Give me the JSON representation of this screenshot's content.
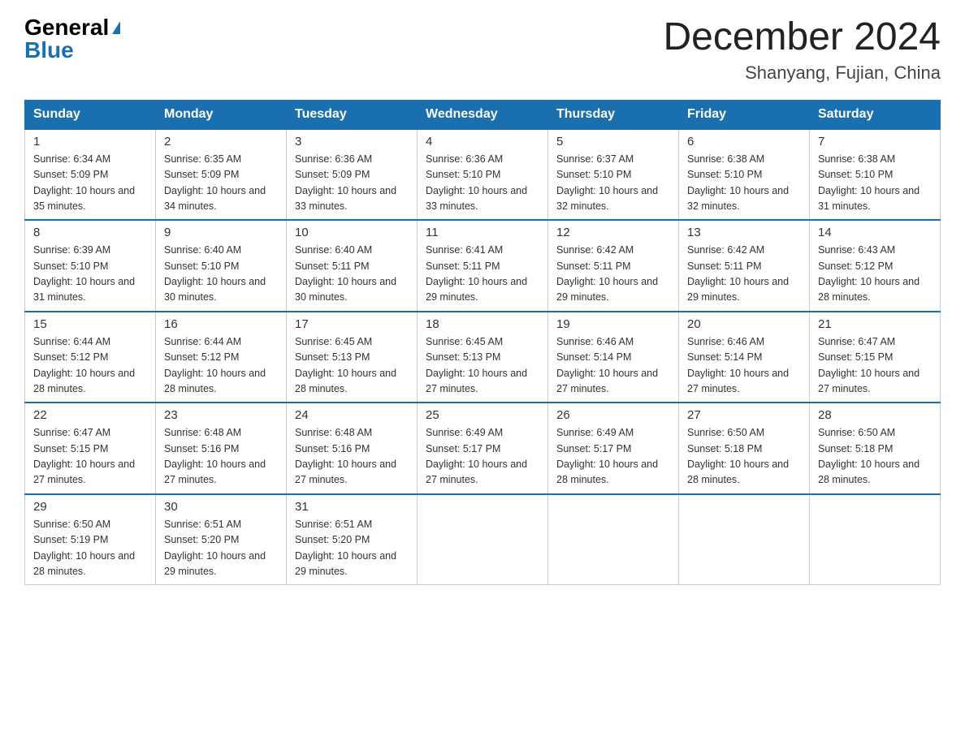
{
  "logo": {
    "general": "General",
    "blue": "Blue",
    "triangle": "▶"
  },
  "title": "December 2024",
  "location": "Shanyang, Fujian, China",
  "days_of_week": [
    "Sunday",
    "Monday",
    "Tuesday",
    "Wednesday",
    "Thursday",
    "Friday",
    "Saturday"
  ],
  "weeks": [
    [
      {
        "day": "1",
        "sunrise": "Sunrise: 6:34 AM",
        "sunset": "Sunset: 5:09 PM",
        "daylight": "Daylight: 10 hours and 35 minutes."
      },
      {
        "day": "2",
        "sunrise": "Sunrise: 6:35 AM",
        "sunset": "Sunset: 5:09 PM",
        "daylight": "Daylight: 10 hours and 34 minutes."
      },
      {
        "day": "3",
        "sunrise": "Sunrise: 6:36 AM",
        "sunset": "Sunset: 5:09 PM",
        "daylight": "Daylight: 10 hours and 33 minutes."
      },
      {
        "day": "4",
        "sunrise": "Sunrise: 6:36 AM",
        "sunset": "Sunset: 5:10 PM",
        "daylight": "Daylight: 10 hours and 33 minutes."
      },
      {
        "day": "5",
        "sunrise": "Sunrise: 6:37 AM",
        "sunset": "Sunset: 5:10 PM",
        "daylight": "Daylight: 10 hours and 32 minutes."
      },
      {
        "day": "6",
        "sunrise": "Sunrise: 6:38 AM",
        "sunset": "Sunset: 5:10 PM",
        "daylight": "Daylight: 10 hours and 32 minutes."
      },
      {
        "day": "7",
        "sunrise": "Sunrise: 6:38 AM",
        "sunset": "Sunset: 5:10 PM",
        "daylight": "Daylight: 10 hours and 31 minutes."
      }
    ],
    [
      {
        "day": "8",
        "sunrise": "Sunrise: 6:39 AM",
        "sunset": "Sunset: 5:10 PM",
        "daylight": "Daylight: 10 hours and 31 minutes."
      },
      {
        "day": "9",
        "sunrise": "Sunrise: 6:40 AM",
        "sunset": "Sunset: 5:10 PM",
        "daylight": "Daylight: 10 hours and 30 minutes."
      },
      {
        "day": "10",
        "sunrise": "Sunrise: 6:40 AM",
        "sunset": "Sunset: 5:11 PM",
        "daylight": "Daylight: 10 hours and 30 minutes."
      },
      {
        "day": "11",
        "sunrise": "Sunrise: 6:41 AM",
        "sunset": "Sunset: 5:11 PM",
        "daylight": "Daylight: 10 hours and 29 minutes."
      },
      {
        "day": "12",
        "sunrise": "Sunrise: 6:42 AM",
        "sunset": "Sunset: 5:11 PM",
        "daylight": "Daylight: 10 hours and 29 minutes."
      },
      {
        "day": "13",
        "sunrise": "Sunrise: 6:42 AM",
        "sunset": "Sunset: 5:11 PM",
        "daylight": "Daylight: 10 hours and 29 minutes."
      },
      {
        "day": "14",
        "sunrise": "Sunrise: 6:43 AM",
        "sunset": "Sunset: 5:12 PM",
        "daylight": "Daylight: 10 hours and 28 minutes."
      }
    ],
    [
      {
        "day": "15",
        "sunrise": "Sunrise: 6:44 AM",
        "sunset": "Sunset: 5:12 PM",
        "daylight": "Daylight: 10 hours and 28 minutes."
      },
      {
        "day": "16",
        "sunrise": "Sunrise: 6:44 AM",
        "sunset": "Sunset: 5:12 PM",
        "daylight": "Daylight: 10 hours and 28 minutes."
      },
      {
        "day": "17",
        "sunrise": "Sunrise: 6:45 AM",
        "sunset": "Sunset: 5:13 PM",
        "daylight": "Daylight: 10 hours and 28 minutes."
      },
      {
        "day": "18",
        "sunrise": "Sunrise: 6:45 AM",
        "sunset": "Sunset: 5:13 PM",
        "daylight": "Daylight: 10 hours and 27 minutes."
      },
      {
        "day": "19",
        "sunrise": "Sunrise: 6:46 AM",
        "sunset": "Sunset: 5:14 PM",
        "daylight": "Daylight: 10 hours and 27 minutes."
      },
      {
        "day": "20",
        "sunrise": "Sunrise: 6:46 AM",
        "sunset": "Sunset: 5:14 PM",
        "daylight": "Daylight: 10 hours and 27 minutes."
      },
      {
        "day": "21",
        "sunrise": "Sunrise: 6:47 AM",
        "sunset": "Sunset: 5:15 PM",
        "daylight": "Daylight: 10 hours and 27 minutes."
      }
    ],
    [
      {
        "day": "22",
        "sunrise": "Sunrise: 6:47 AM",
        "sunset": "Sunset: 5:15 PM",
        "daylight": "Daylight: 10 hours and 27 minutes."
      },
      {
        "day": "23",
        "sunrise": "Sunrise: 6:48 AM",
        "sunset": "Sunset: 5:16 PM",
        "daylight": "Daylight: 10 hours and 27 minutes."
      },
      {
        "day": "24",
        "sunrise": "Sunrise: 6:48 AM",
        "sunset": "Sunset: 5:16 PM",
        "daylight": "Daylight: 10 hours and 27 minutes."
      },
      {
        "day": "25",
        "sunrise": "Sunrise: 6:49 AM",
        "sunset": "Sunset: 5:17 PM",
        "daylight": "Daylight: 10 hours and 27 minutes."
      },
      {
        "day": "26",
        "sunrise": "Sunrise: 6:49 AM",
        "sunset": "Sunset: 5:17 PM",
        "daylight": "Daylight: 10 hours and 28 minutes."
      },
      {
        "day": "27",
        "sunrise": "Sunrise: 6:50 AM",
        "sunset": "Sunset: 5:18 PM",
        "daylight": "Daylight: 10 hours and 28 minutes."
      },
      {
        "day": "28",
        "sunrise": "Sunrise: 6:50 AM",
        "sunset": "Sunset: 5:18 PM",
        "daylight": "Daylight: 10 hours and 28 minutes."
      }
    ],
    [
      {
        "day": "29",
        "sunrise": "Sunrise: 6:50 AM",
        "sunset": "Sunset: 5:19 PM",
        "daylight": "Daylight: 10 hours and 28 minutes."
      },
      {
        "day": "30",
        "sunrise": "Sunrise: 6:51 AM",
        "sunset": "Sunset: 5:20 PM",
        "daylight": "Daylight: 10 hours and 29 minutes."
      },
      {
        "day": "31",
        "sunrise": "Sunrise: 6:51 AM",
        "sunset": "Sunset: 5:20 PM",
        "daylight": "Daylight: 10 hours and 29 minutes."
      },
      null,
      null,
      null,
      null
    ]
  ]
}
